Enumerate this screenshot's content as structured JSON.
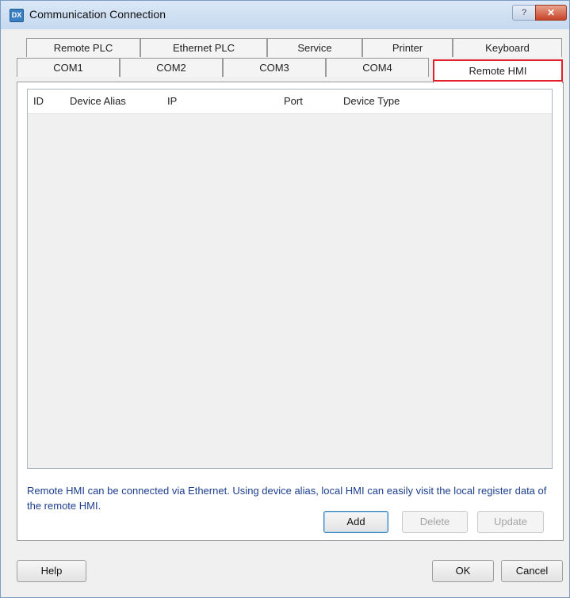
{
  "window": {
    "title": "Communication Connection",
    "app_icon_text": "DX"
  },
  "titlebar": {
    "help_glyph": "?",
    "close_glyph": "✕"
  },
  "tabs": {
    "row1": [
      "Remote PLC",
      "Ethernet PLC",
      "Service",
      "Printer",
      "Keyboard"
    ],
    "row2": [
      "COM1",
      "COM2",
      "COM3",
      "COM4",
      "Remote HMI"
    ],
    "active": "Remote HMI"
  },
  "table": {
    "columns": [
      "ID",
      "Device Alias",
      "IP",
      "Port",
      "Device Type"
    ],
    "rows": []
  },
  "info": "Remote HMI can be connected via Ethernet. Using device alias, local HMI can easily visit the local register data of the remote HMI.",
  "buttons": {
    "add": "Add",
    "delete": "Delete",
    "update": "Update",
    "help": "Help",
    "ok": "OK",
    "cancel": "Cancel"
  },
  "colors": {
    "highlight": "#e0202a",
    "info_text": "#1d3f8f"
  }
}
